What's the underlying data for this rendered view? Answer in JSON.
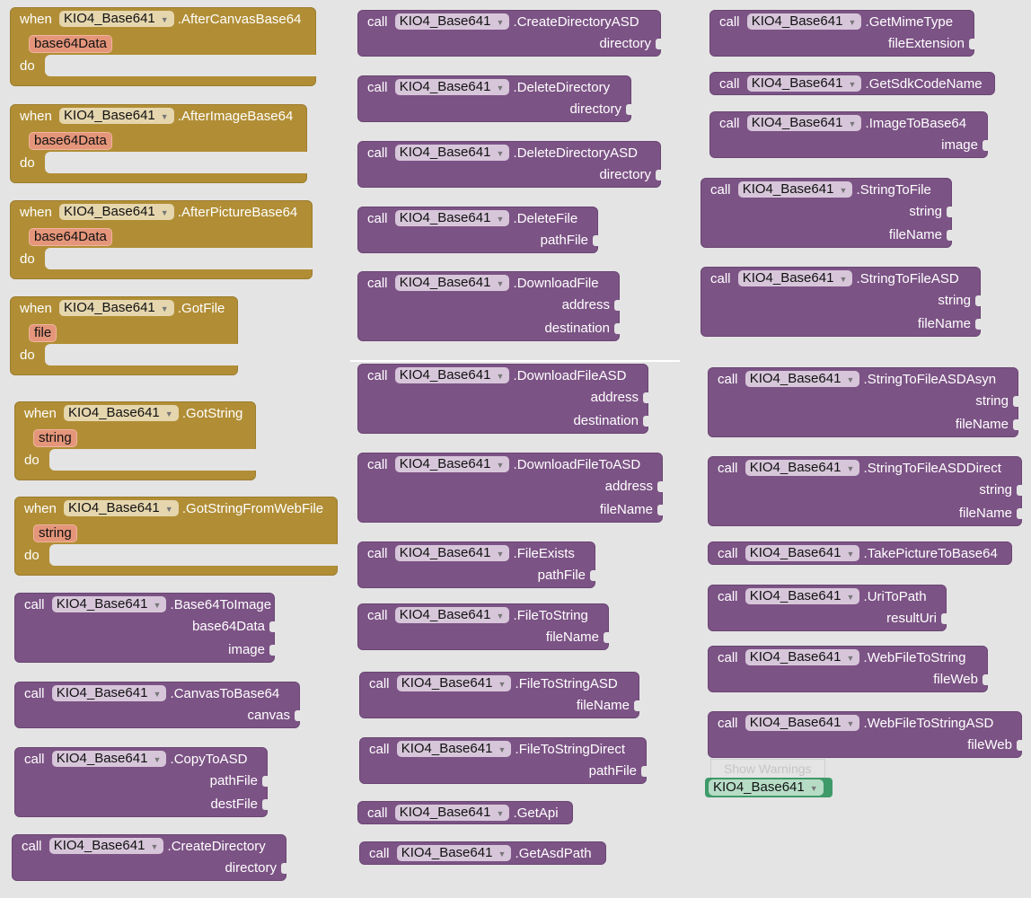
{
  "component": "KIO4_Base641",
  "keywords": {
    "when": "when",
    "do": "do",
    "call": "call"
  },
  "show_warnings": "Show Warnings",
  "colors": {
    "event": "#b18e35",
    "method": "#7c5385",
    "param": "#e4957a",
    "component_block": "#3f9a6a"
  },
  "events": [
    {
      "name": ".AfterCanvasBase64",
      "param": "base64Data"
    },
    {
      "name": ".AfterImageBase64",
      "param": "base64Data"
    },
    {
      "name": ".AfterPictureBase64",
      "param": "base64Data"
    },
    {
      "name": ".GotFile",
      "param": "file"
    },
    {
      "name": ".GotString",
      "param": "string"
    },
    {
      "name": ".GotStringFromWebFile",
      "param": "string"
    }
  ],
  "methods": [
    {
      "name": ".Base64ToImage",
      "params": [
        "base64Data",
        "image"
      ]
    },
    {
      "name": ".CanvasToBase64",
      "params": [
        "canvas"
      ]
    },
    {
      "name": ".CopyToASD",
      "params": [
        "pathFile",
        "destFile"
      ]
    },
    {
      "name": ".CreateDirectory",
      "params": [
        "directory"
      ]
    },
    {
      "name": ".CreateDirectoryASD",
      "params": [
        "directory"
      ]
    },
    {
      "name": ".DeleteDirectory",
      "params": [
        "directory"
      ]
    },
    {
      "name": ".DeleteDirectoryASD",
      "params": [
        "directory"
      ]
    },
    {
      "name": ".DeleteFile",
      "params": [
        "pathFile"
      ]
    },
    {
      "name": ".DownloadFile",
      "params": [
        "address",
        "destination"
      ]
    },
    {
      "name": ".DownloadFileASD",
      "params": [
        "address",
        "destination"
      ]
    },
    {
      "name": ".DownloadFileToASD",
      "params": [
        "address",
        "fileName"
      ]
    },
    {
      "name": ".FileExists",
      "params": [
        "pathFile"
      ]
    },
    {
      "name": ".FileToString",
      "params": [
        "fileName"
      ]
    },
    {
      "name": ".FileToStringASD",
      "params": [
        "fileName"
      ]
    },
    {
      "name": ".FileToStringDirect",
      "params": [
        "pathFile"
      ]
    },
    {
      "name": ".GetApi",
      "params": []
    },
    {
      "name": ".GetAsdPath",
      "params": []
    },
    {
      "name": ".GetMimeType",
      "params": [
        "fileExtension"
      ]
    },
    {
      "name": ".GetSdkCodeName",
      "params": []
    },
    {
      "name": ".ImageToBase64",
      "params": [
        "image"
      ]
    },
    {
      "name": ".StringToFile",
      "params": [
        "string",
        "fileName"
      ]
    },
    {
      "name": ".StringToFileASD",
      "params": [
        "string",
        "fileName"
      ]
    },
    {
      "name": ".StringToFileASDAsyn",
      "params": [
        "string",
        "fileName"
      ]
    },
    {
      "name": ".StringToFileASDDirect",
      "params": [
        "string",
        "fileName"
      ]
    },
    {
      "name": ".TakePictureToBase64",
      "params": []
    },
    {
      "name": ".UriToPath",
      "params": [
        "resultUri"
      ]
    },
    {
      "name": ".WebFileToString",
      "params": [
        "fileWeb"
      ]
    },
    {
      "name": ".WebFileToStringASD",
      "params": [
        "fileWeb"
      ]
    }
  ]
}
